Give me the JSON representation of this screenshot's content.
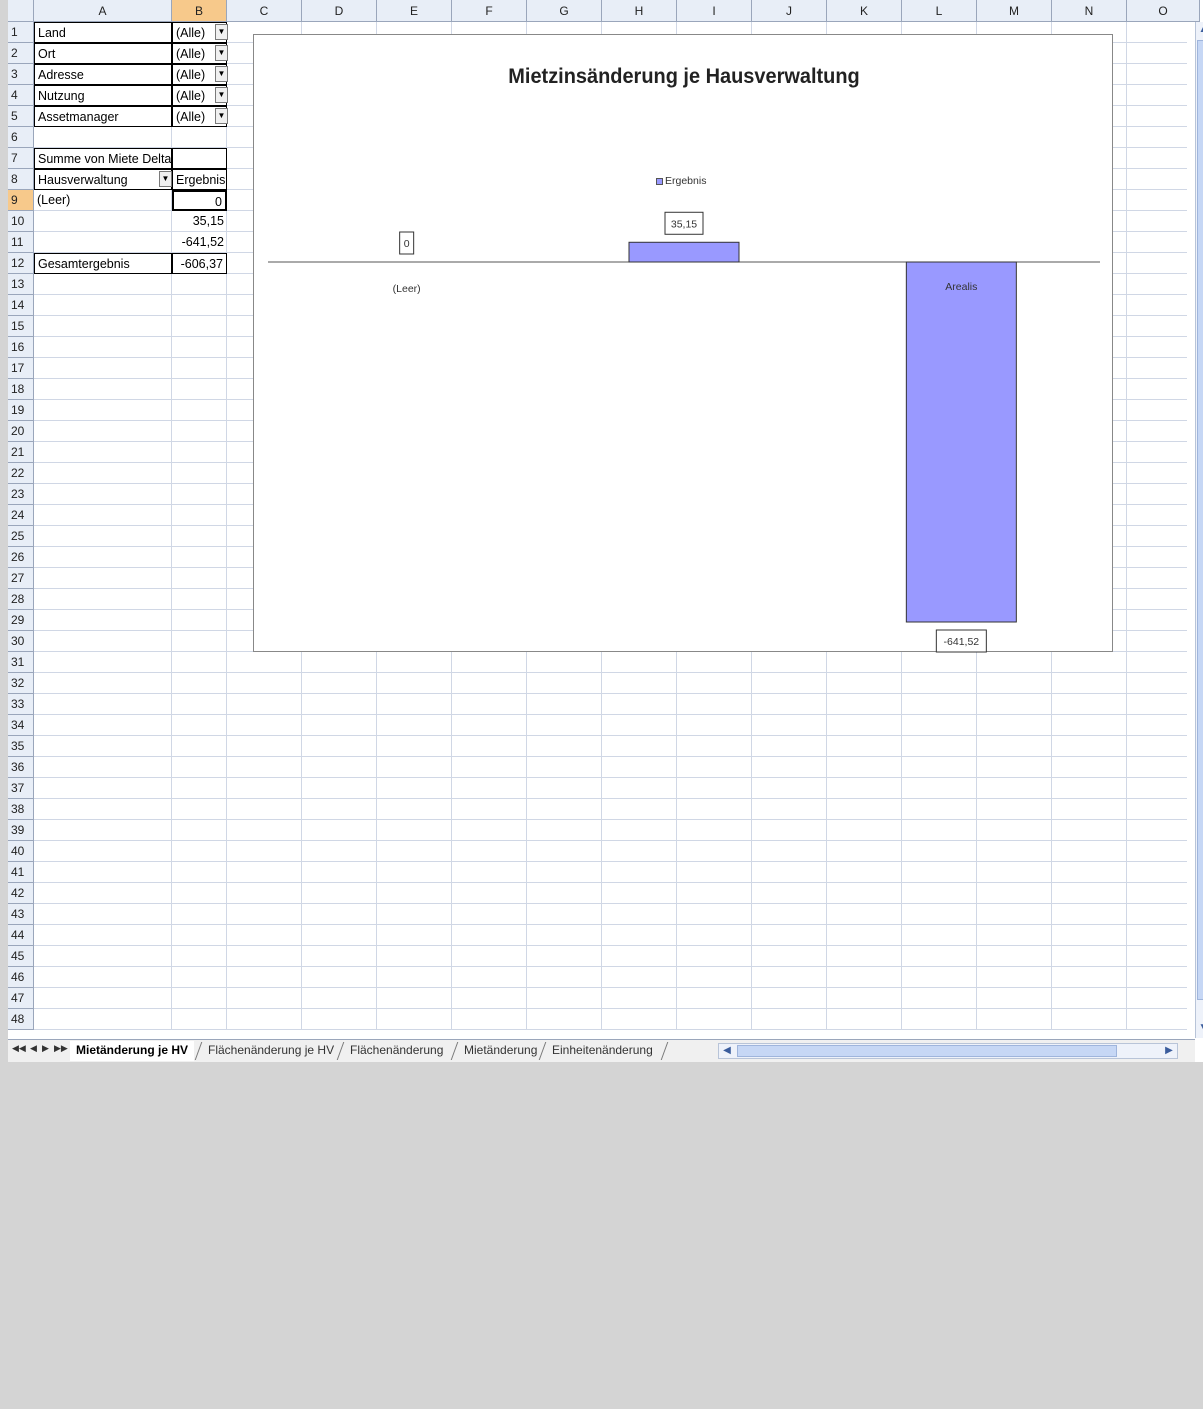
{
  "columns": [
    "A",
    "B",
    "C",
    "D",
    "E",
    "F",
    "G",
    "H",
    "I",
    "J",
    "K",
    "L",
    "M",
    "N",
    "O"
  ],
  "selected_column": "B",
  "selected_row": 9,
  "row_count": 48,
  "pivot": {
    "filters": [
      {
        "label": "Land",
        "value": "(Alle)"
      },
      {
        "label": "Ort",
        "value": "(Alle)"
      },
      {
        "label": "Adresse",
        "value": "(Alle)"
      },
      {
        "label": "Nutzung",
        "value": "(Alle)"
      },
      {
        "label": "Assetmanager",
        "value": "(Alle)"
      }
    ],
    "data_field": "Summe von Miete Delta",
    "row_field": "Hausverwaltung",
    "result_header": "Ergebnis",
    "rows": [
      {
        "label": "(Leer)",
        "value": "0"
      },
      {
        "label": "",
        "value": "35,15"
      },
      {
        "label": "",
        "value": "-641,52"
      }
    ],
    "total_label": "Gesamtergebnis",
    "total_value": "-606,37"
  },
  "chart_data": {
    "type": "bar",
    "title": "Mietzinsänderung je Hausverwaltung",
    "categories": [
      "(Leer)",
      "",
      "Arealis"
    ],
    "series": [
      {
        "name": "Ergebnis",
        "values": [
          0,
          35.15,
          -641.52
        ],
        "labels": [
          "0",
          "35,15",
          "-641,52"
        ]
      }
    ],
    "bar_color": "#9999ff",
    "legend_position": "top",
    "xlabel": "",
    "ylabel": ""
  },
  "sheet_tabs": [
    {
      "label": "Mietänderung je HV",
      "active": true
    },
    {
      "label": "Flächenänderung je HV",
      "active": false
    },
    {
      "label": "Flächenänderung",
      "active": false
    },
    {
      "label": "Mietänderung",
      "active": false
    },
    {
      "label": "Einheitenänderung",
      "active": false
    }
  ]
}
